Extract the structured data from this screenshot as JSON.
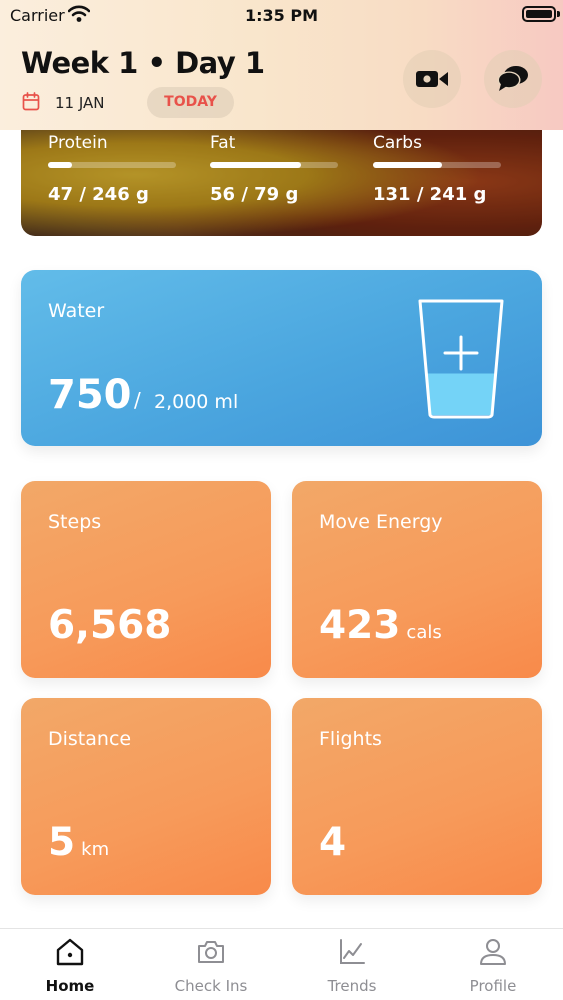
{
  "status_bar": {
    "carrier": "Carrier",
    "time": "1:35 PM"
  },
  "header": {
    "title": "Week 1 • Day 1",
    "date": "11 JAN",
    "today_label": "TODAY",
    "icons": {
      "calendar": "calendar-icon",
      "video": "video-camera-icon",
      "chat": "chat-bubbles-icon"
    }
  },
  "macros": [
    {
      "label": "Protein",
      "value": "47 / 246 g",
      "progress": 0.19
    },
    {
      "label": "Fat",
      "value": "56 / 79 g",
      "progress": 0.71
    },
    {
      "label": "Carbs",
      "value": "131 / 241 g",
      "progress": 0.54
    }
  ],
  "water": {
    "title": "Water",
    "amount": "750",
    "separator": "/",
    "goal": "2,000 ml",
    "fill_fraction": 0.375
  },
  "stats": [
    {
      "title": "Steps",
      "value": "6,568",
      "unit": ""
    },
    {
      "title": "Move Energy",
      "value": "423",
      "unit": "cals"
    },
    {
      "title": "Distance",
      "value": "5",
      "unit": "km"
    },
    {
      "title": "Flights",
      "value": "4",
      "unit": ""
    }
  ],
  "tabs": [
    {
      "label": "Home",
      "icon": "home-icon",
      "active": true
    },
    {
      "label": "Check Ins",
      "icon": "camera-icon",
      "active": false
    },
    {
      "label": "Trends",
      "icon": "chart-icon",
      "active": false
    },
    {
      "label": "Profile",
      "icon": "person-icon",
      "active": false
    }
  ],
  "colors": {
    "accent_today": "#e8524a",
    "water_blue": "#4ba6df",
    "stat_orange": "#f79a5a",
    "tab_active": "#111111",
    "tab_inactive": "#8e8e93"
  }
}
